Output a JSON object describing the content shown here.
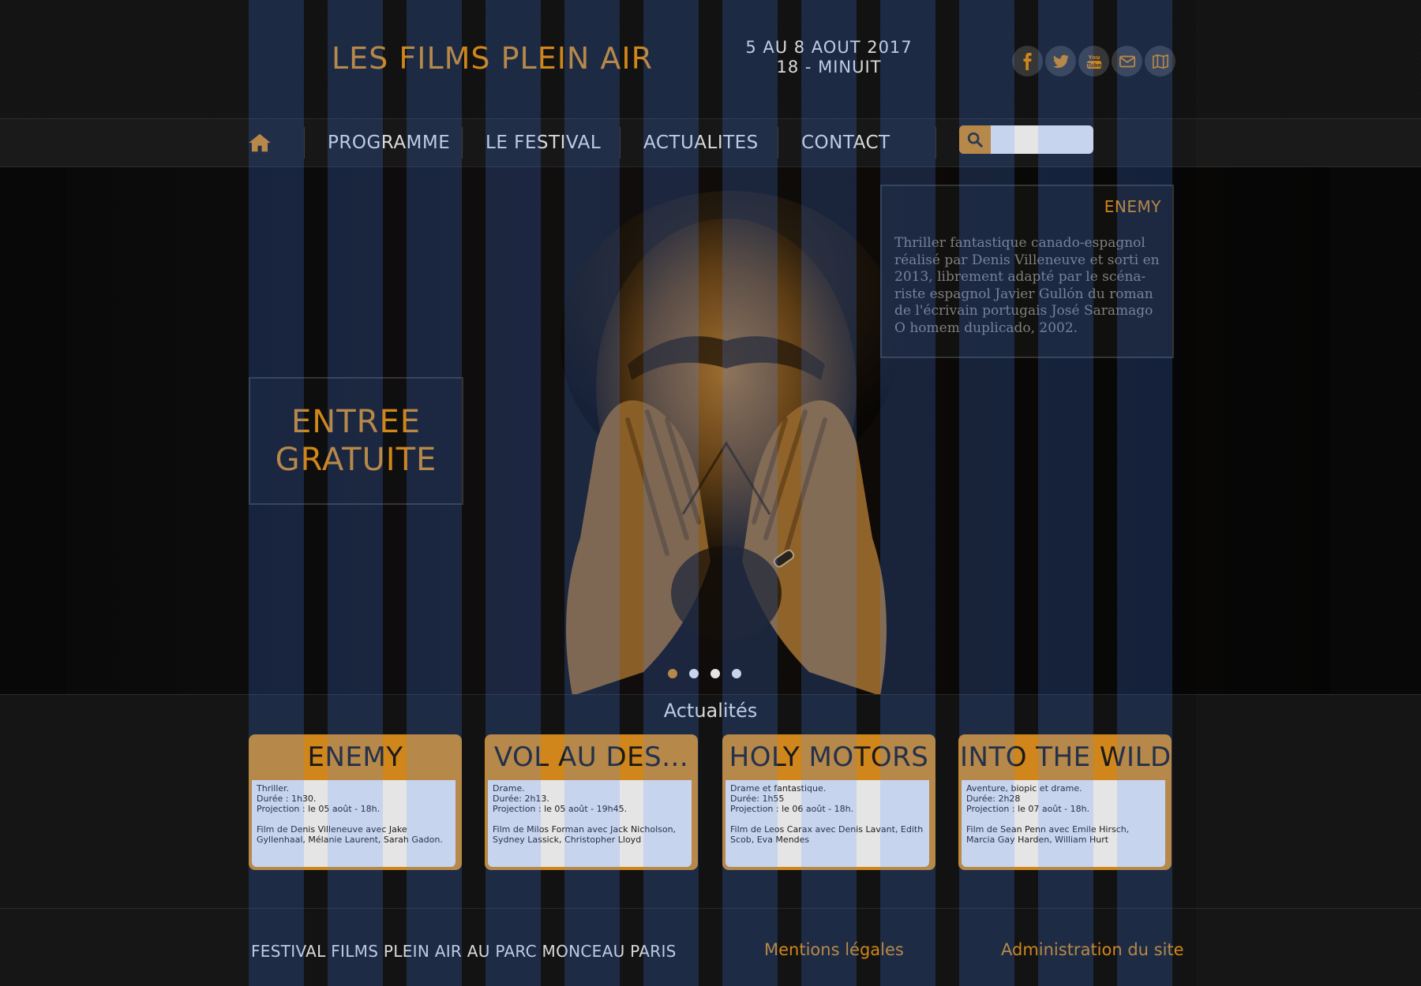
{
  "header": {
    "title": "LES FILMS PLEIN AIR",
    "dates_line1": "5 AU 8 AOUT 2017",
    "dates_line2": "18 - MINUIT"
  },
  "socials": [
    {
      "name": "facebook-icon"
    },
    {
      "name": "twitter-icon"
    },
    {
      "name": "youtube-icon",
      "text": "You Tube"
    },
    {
      "name": "mail-icon"
    },
    {
      "name": "map-icon"
    }
  ],
  "nav": {
    "items": [
      "PROGRAMME",
      "LE FESTIVAL",
      "ACTUALITES",
      "CONTACT"
    ],
    "search_placeholder": ""
  },
  "hero": {
    "promo_line1": "ENTREE",
    "promo_line2": "GRATUITE",
    "info_title": "ENEMY",
    "info_text": " Thriller fantastique canado-espagnol réalisé par Denis Villeneuve et sorti en 2013, librement adapté par le scéna-riste espagnol Javier Gullón du roman de l'écrivain portugais José Saramago O homem duplicado, 2002.",
    "active_slide": 1,
    "slide_count": 4
  },
  "news": {
    "heading": "Actualités",
    "cards": [
      {
        "title": "ENEMY",
        "genre": "Thriller.",
        "duration": "Durée : 1h30.",
        "projection": "Projection : le 05 août - 18h.",
        "credits": "Film de Denis Villeneuve avec Jake Gyllenhaal, Mélanie Laurent, Sarah Gadon."
      },
      {
        "title": "VOL AU DES...",
        "genre": "Drame.",
        "duration": "Durée: 2h13.",
        "projection": "Projection : le 05 août - 19h45.",
        "credits": "Film de Milos Forman avec Jack Nicholson, Sydney Lassick, Christopher Lloyd"
      },
      {
        "title": "HOLY MOTORS",
        "genre": "Drame et fantastique.",
        "duration": "Durée: 1h55",
        "projection": "Projection : le 06 août - 18h.",
        "credits": "Film de Leos Carax avec Denis Lavant, Edith Scob, Eva Mendes"
      },
      {
        "title": "INTO THE WILD",
        "genre": "Aventure, biopic et drame.",
        "duration": "Durée: 2h28",
        "projection": "Projection : le 07 août - 18h.",
        "credits": "Film de Sean Penn avec Emile Hirsch, Marcia Gay Harden, William Hurt"
      }
    ]
  },
  "footer": {
    "left": "FESTIVAL FILMS PLEIN AIR AU PARC MONCEAU PARIS",
    "mentions": "Mentions légales",
    "admin": "Administration du site"
  },
  "colors": {
    "accent": "#e8961e",
    "background": "#131313",
    "grid_overlay": "#3764be"
  }
}
